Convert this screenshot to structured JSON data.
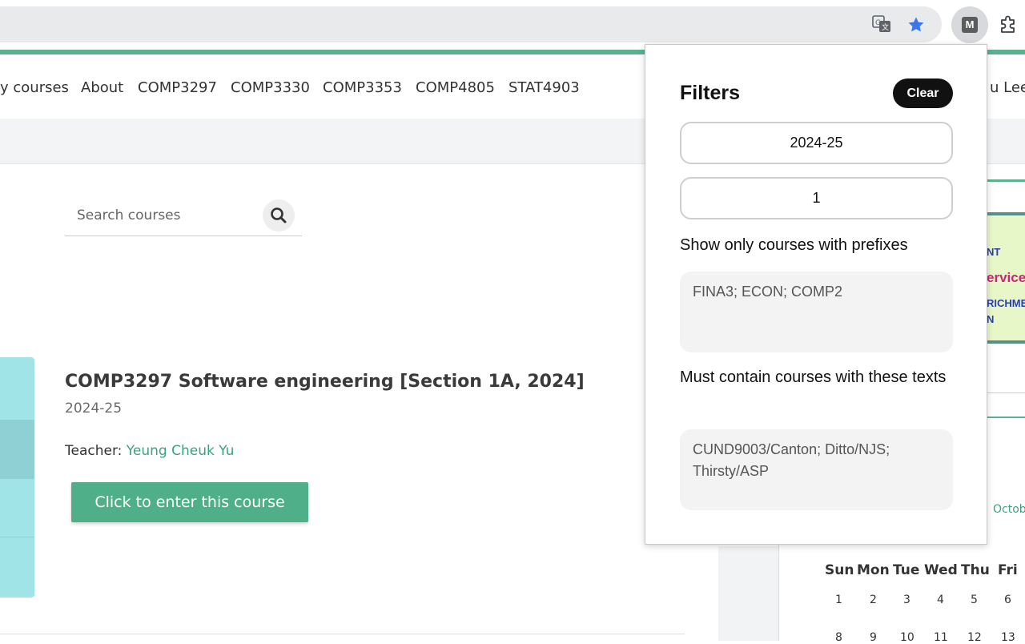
{
  "browser": {
    "extension_badge": "M",
    "icons": [
      "translate-icon",
      "bookmark-star-icon",
      "extension-m-icon",
      "puzzle-extensions-icon"
    ]
  },
  "nav": {
    "items": [
      "y courses",
      "About",
      "COMP3297",
      "COMP3330",
      "COMP3353",
      "COMP4805",
      "STAT4903"
    ],
    "user": "u Lee"
  },
  "search": {
    "placeholder": "Search courses"
  },
  "course": {
    "title": "COMP3297 Software engineering [Section 1A, 2024]",
    "year": "2024-25",
    "teacher_label": "Teacher:",
    "teacher_name": "Yeung Cheuk Yu",
    "enter_label": "Click to enter this course"
  },
  "right_column": {
    "banner_lines": [
      "NT",
      "ervice",
      "RICHME",
      "N"
    ],
    "month_link": "Octob",
    "weekdays": [
      "Sun",
      "Mon",
      "Tue",
      "Wed",
      "Thu",
      "Fri"
    ],
    "week1": [
      "1",
      "2",
      "3",
      "4",
      "5",
      "6"
    ],
    "week2": [
      "8",
      "9",
      "10",
      "11",
      "12",
      "13"
    ]
  },
  "popup": {
    "title": "Filters",
    "clear_label": "Clear",
    "year_value": "2024-25",
    "semester_value": "1",
    "prefix_label": "Show only courses with prefixes",
    "prefix_value": "FINA3; ECON; COMP2",
    "contains_label": "Must contain courses with these texts",
    "contains_value": "CUND9003/Canton; Ditto/NJS; Thirsty/ASP"
  },
  "colors": {
    "accent_green": "#5bb28e",
    "link_green": "#3aa37d",
    "button_green": "#4eaf88",
    "course_image": "#a1e4e8"
  }
}
